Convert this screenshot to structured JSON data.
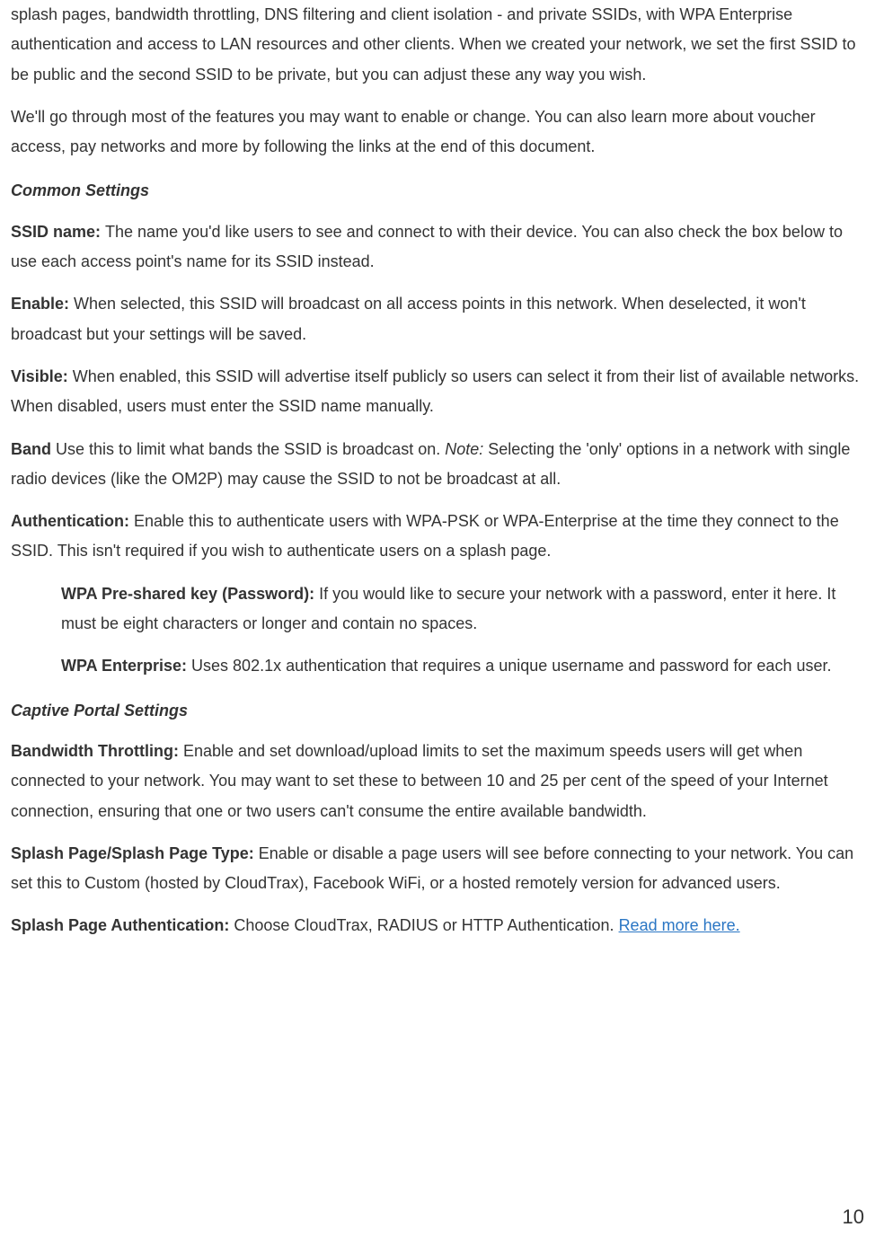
{
  "para1": "splash pages, bandwidth throttling, DNS filtering and client isolation - and private SSIDs, with WPA Enterprise authentication and access to LAN resources and other clients. When we created your network, we set the first SSID to be public and the second SSID to be private, but you can adjust these any way you wish.",
  "para2": "We'll go through most of the features you may want to enable or change. You can also learn more about voucher access, pay networks and more by following the links at the end of this document.",
  "heading_common": "Common Settings",
  "ssid_label": "SSID name: ",
  "ssid_text": "The name you'd like users to see and connect to with their device. You can also check the box below to use each access point's name for its SSID instead.",
  "enable_label": "Enable: ",
  "enable_text": "When selected, this SSID will broadcast on all access points in this network. When deselected, it won't broadcast but your settings will be saved.",
  "visible_label": "Visible: ",
  "visible_text": "When enabled, this SSID will advertise itself publicly so users can select it from their list of available networks. When disabled, users must enter the SSID name manually.",
  "band_label": "Band ",
  "band_text1": "Use this to limit what bands the SSID is broadcast on. ",
  "band_note_label": "Note: ",
  "band_text2": "Selecting the 'only' options in a network with single radio devices (like the OM2P) may cause the SSID to not be broadcast at all.",
  "auth_label": "Authentication: ",
  "auth_text": "Enable this to authenticate users with WPA-PSK or WPA-Enterprise at the time they connect to the SSID. This isn't required if you wish to authenticate users on a splash page.",
  "wpa_psk_label": "WPA Pre-shared key (Password): ",
  "wpa_psk_text": "If you would like to secure your network with a password, enter it here. It must be eight characters or longer and contain no spaces.",
  "wpa_ent_label": "WPA Enterprise: ",
  "wpa_ent_text": "Uses 802.1x authentication that requires a unique username and password for each user.",
  "heading_captive": "Captive Portal Settings",
  "bandwidth_label": "Bandwidth Throttling: ",
  "bandwidth_text": "Enable and set download/upload limits to set the maximum speeds users will get when connected to your network. You may want to set these to between 10 and 25 per cent of the speed of your Internet connection, ensuring that one or two users can't consume the entire available bandwidth.",
  "splash_label": "Splash Page/Splash Page Type: ",
  "splash_text": "Enable or disable a page users will see before connecting to your network. You can set this to Custom (hosted by CloudTrax), Facebook WiFi, or a hosted remotely version for advanced users.",
  "splash_auth_label": "Splash Page Authentication: ",
  "splash_auth_text": "Choose CloudTrax, RADIUS or HTTP Authentication. ",
  "splash_auth_link": "Read more here. ",
  "page_number": "10"
}
